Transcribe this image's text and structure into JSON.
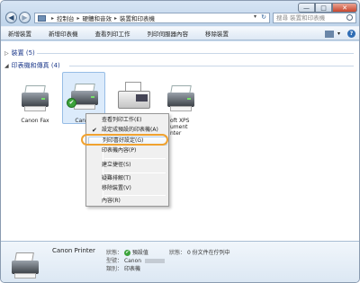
{
  "window": {
    "controls": {
      "minimize": "—",
      "maximize": "□",
      "close": "✕"
    }
  },
  "nav": {
    "back": "◀",
    "forward": "▶"
  },
  "address": {
    "segments": [
      "控制台",
      "硬體和音效",
      "裝置和印表機"
    ],
    "separator": "▸",
    "dropdown": "▾",
    "refresh": "↻"
  },
  "search": {
    "placeholder": "搜尋 裝置和印表機"
  },
  "toolbar": {
    "items": [
      "新增裝置",
      "新增印表機",
      "查看列印工作",
      "列印伺服器內容",
      "移除裝置"
    ],
    "view_caret": "▾",
    "help": "?"
  },
  "groups": [
    {
      "label": "裝置 (5)",
      "collapsed": true,
      "triangle": "▷"
    },
    {
      "label": "印表機和傳真 (4)",
      "collapsed": false,
      "triangle": "◢"
    }
  ],
  "printers": [
    {
      "label": "Canon Fax",
      "type": "printer",
      "selected": false,
      "default": false
    },
    {
      "label": "Canon",
      "type": "printer",
      "selected": true,
      "default": true
    },
    {
      "label": "",
      "type": "fax",
      "selected": false,
      "default": false
    },
    {
      "label": "oft XPS",
      "label2": "ument",
      "label3": "nter",
      "type": "printer",
      "selected": false,
      "default": false
    }
  ],
  "context_menu": {
    "items": [
      {
        "label": "查看列印工作(E)",
        "checked": false,
        "highlighted": false
      },
      {
        "label": "設定成預設的印表機(A)",
        "checked": true,
        "highlighted": false
      },
      {
        "label": "列印喜好設定(G)",
        "checked": false,
        "highlighted": true
      },
      {
        "label": "印表機內容(P)",
        "checked": false,
        "highlighted": false
      },
      {
        "label": "建立捷徑(S)",
        "checked": false,
        "highlighted": false
      },
      {
        "label": "疑難排解(T)",
        "checked": false,
        "highlighted": false
      },
      {
        "label": "移除裝置(V)",
        "checked": false,
        "highlighted": false
      },
      {
        "label": "內容(R)",
        "checked": false,
        "highlighted": false
      }
    ],
    "check_glyph": "✔"
  },
  "details": {
    "name": "Canon Printer",
    "status_key": "狀態：",
    "status_value": "預設值",
    "model_key": "型號：",
    "model_value": "Canon",
    "category_key": "類別：",
    "category_value": "印表機",
    "queue_key": "狀態：",
    "queue_value": "0 份文件在佇列中"
  },
  "colors": {
    "highlight_callout": "#f0a230",
    "group_header": "#1f3b8c",
    "default_check": "#3ca33b"
  }
}
